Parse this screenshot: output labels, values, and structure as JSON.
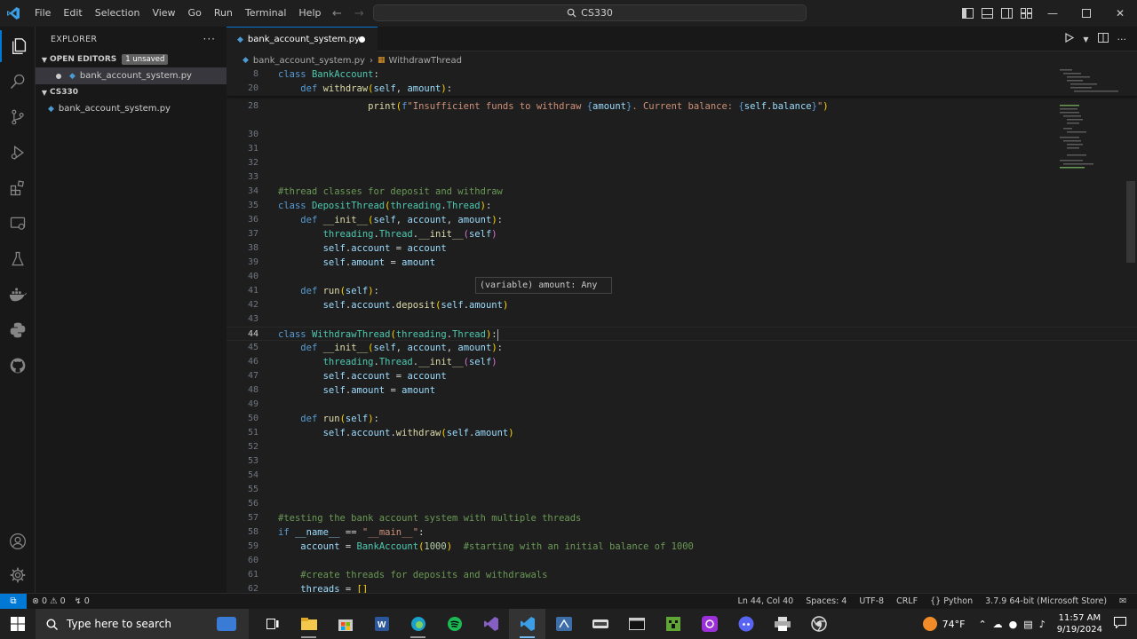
{
  "titlebar": {
    "menu": [
      "File",
      "Edit",
      "Selection",
      "View",
      "Go",
      "Run",
      "Terminal",
      "Help"
    ],
    "search_text": "CS330"
  },
  "sidebar": {
    "title": "EXPLORER",
    "open_editors_label": "OPEN EDITORS",
    "unsaved_badge": "1 unsaved",
    "open_file": "bank_account_system.py",
    "folder_label": "CS330",
    "files": [
      "bank_account_system.py"
    ]
  },
  "tab": {
    "label": "bank_account_system.py"
  },
  "breadcrumb": {
    "file": "bank_account_system.py",
    "symbol": "WithdrawThread"
  },
  "editor": {
    "current_line": 44,
    "line_numbers": [
      "8",
      "20",
      "28",
      "30",
      "31",
      "32",
      "33",
      "34",
      "35",
      "36",
      "37",
      "38",
      "39",
      "40",
      "41",
      "42",
      "43",
      "44",
      "45",
      "46",
      "47",
      "48",
      "49",
      "50",
      "51",
      "52",
      "53",
      "54",
      "55",
      "56",
      "57",
      "58",
      "59",
      "60",
      "61",
      "62"
    ]
  },
  "hover": {
    "text": "(variable) amount: Any"
  },
  "statusbar": {
    "errors": "0",
    "warnings": "0",
    "ports": "0",
    "position": "Ln 44, Col 40",
    "spaces": "Spaces: 4",
    "encoding": "UTF-8",
    "eol": "CRLF",
    "language": "Python",
    "interpreter": "3.7.9 64-bit (Microsoft Store)"
  },
  "taskbar": {
    "search_placeholder": "Type here to search",
    "weather": "74°F",
    "time": "11:57 AM",
    "date": "9/19/2024"
  },
  "colors": {
    "accent": "#0078d4",
    "editor_bg": "#1e1e1e",
    "sidebar_bg": "#181818"
  }
}
